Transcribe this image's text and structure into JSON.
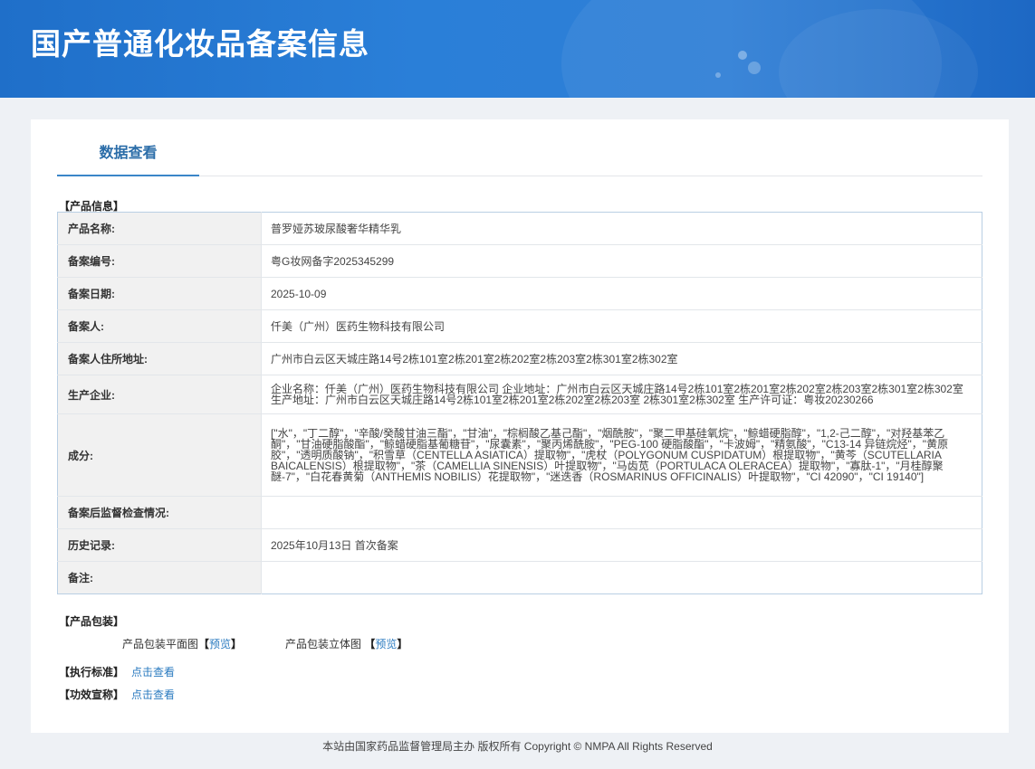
{
  "site": {
    "title": "国产普通化妆品备案信息"
  },
  "tabs": [
    {
      "label": "数据查看",
      "active": true
    }
  ],
  "product_info": {
    "section_label": "【产品信息】",
    "rows": [
      {
        "key": "产品名称:",
        "value": "普罗娅苏玻尿酸奢华精华乳"
      },
      {
        "key": "备案编号:",
        "value": "粤G妆网备字2025345299"
      },
      {
        "key": "备案日期:",
        "value": "2025-10-09"
      },
      {
        "key": "备案人:",
        "value": "仟美（广州）医药生物科技有限公司"
      },
      {
        "key": "备案人住所地址:",
        "value": "广州市白云区天城庄路14号2栋101室2栋201室2栋202室2栋203室2栋301室2栋302室"
      },
      {
        "key": "生产企业:",
        "value": "企业名称：仟美（广州）医药生物科技有限公司 企业地址：广州市白云区天城庄路14号2栋101室2栋201室2栋202室2栋203室2栋301室2栋302室 生产地址：广州市白云区天城庄路14号2栋101室2栋201室2栋202室2栋203室 2栋301室2栋302室 生产许可证：粤妆20230266"
      },
      {
        "key": "成分:",
        "value": "[\"水\"，\"丁二醇\"，\"辛酸/癸酸甘油三酯\"，\"甘油\"，\"棕榈酸乙基己酯\"，\"烟酰胺\"，\"聚二甲基硅氧烷\"，\"鲸蜡硬脂醇\"，\"1,2-己二醇\"，\"对羟基苯乙酮\"，\"甘油硬脂酸酯\"，\"鲸蜡硬脂基葡糖苷\"，\"尿囊素\"，\"聚丙烯酰胺\"，\"PEG-100 硬脂酸酯\"，\"卡波姆\"，\"精氨酸\"，\"C13-14 异链烷烃\"，\"黄原胶\"，\"透明质酸钠\"，\"积雪草（CENTELLA ASIATICA）提取物\"，\"虎杖（POLYGONUM CUSPIDATUM）根提取物\"，\"黄芩（SCUTELLARIA BAICALENSIS）根提取物\"，\"茶（CAMELLIA SINENSIS）叶提取物\"，\"马齿苋（PORTULACA OLERACEA）提取物\"，\"寡肽-1\"，\"月桂醇聚醚-7\"，\"白花春黄菊（ANTHEMIS NOBILIS）花提取物\"，\"迷迭香（ROSMARINUS OFFICINALIS）叶提取物\"，\"CI 42090\"，\"CI 19140\"]"
      },
      {
        "key": "备案后监督检查情况:",
        "value": ""
      },
      {
        "key": "历史记录:",
        "value": "2025年10月13日 首次备案"
      },
      {
        "key": "备注:",
        "value": ""
      }
    ]
  },
  "packaging": {
    "section_label": "【产品包装】",
    "flat_label": "产品包装平面图",
    "solid_label": "产品包装立体图",
    "bracket_open": "【",
    "bracket_close": "】",
    "preview_link": "预览"
  },
  "standard": {
    "label": "【执行标准】",
    "link": "点击查看"
  },
  "efficacy": {
    "label": "【功效宣称】",
    "link": "点击查看"
  },
  "footer": {
    "text": "本站由国家药品监督管理局主办 版权所有 Copyright © NMPA All Rights Reserved"
  }
}
